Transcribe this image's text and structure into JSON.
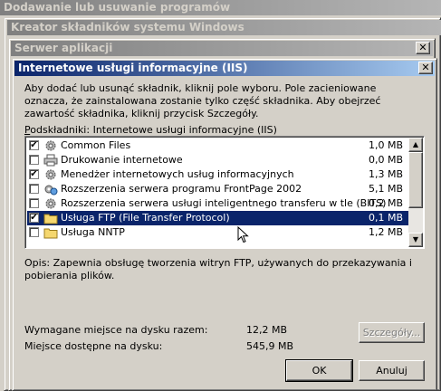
{
  "windows": {
    "bg1_title": "Dodawanie lub usuwanie programów",
    "bg2_title": "Kreator składników systemu Windows",
    "bg3_title": "Serwer aplikacji",
    "dialog_title": "Internetowe usługi informacyjne (IIS)"
  },
  "description": "Aby dodać lub usunąć składnik, kliknij pole wyboru. Pole zacieniowane oznacza, że zainstalowana zostanie tylko część składnika. Aby obejrzeć zawartość składnika, kliknij przycisk Szczegóły.",
  "subcomponents_label_prefix": "P",
  "subcomponents_label_rest": "odskładniki: Internetowe usługi informacyjne (IIS)",
  "items": [
    {
      "label": "Common Files",
      "size": "1,0 MB",
      "checked": true,
      "partial": false,
      "icon": "gear-icon"
    },
    {
      "label": "Drukowanie internetowe",
      "size": "0,0 MB",
      "checked": false,
      "partial": false,
      "icon": "printer-icon"
    },
    {
      "label": "Menedżer internetowych usług informacyjnych",
      "size": "1,3 MB",
      "checked": true,
      "partial": false,
      "icon": "gear-icon"
    },
    {
      "label": "Rozszerzenia serwera programu FrontPage 2002",
      "size": "5,1 MB",
      "checked": false,
      "partial": false,
      "icon": "gear-globe-icon"
    },
    {
      "label": "Rozszerzenia serwera usługi inteligentnego transferu w tle (BITS)",
      "size": "0,2 MB",
      "checked": false,
      "partial": false,
      "icon": "gear-icon"
    },
    {
      "label": "Usługa FTP (File Transfer Protocol)",
      "size": "0,1 MB",
      "checked": true,
      "partial": false,
      "icon": "folder-icon",
      "selected": true
    },
    {
      "label": "Usługa NNTP",
      "size": "1,2 MB",
      "checked": false,
      "partial": false,
      "icon": "folder-icon"
    }
  ],
  "opis": "Opis:  Zapewnia obsługę tworzenia witryn FTP, używanych do przekazywania i pobierania plików.",
  "required_label": "Wymagane miejsce na dysku razem:",
  "required_value": "12,2 MB",
  "available_label": "Miejsce dostępne na dysku:",
  "available_value": "545,9 MB",
  "buttons": {
    "details": "Szczegóły...",
    "ok": "OK",
    "cancel": "Anuluj"
  },
  "close_glyph": "✕",
  "check_glyph": "✔"
}
